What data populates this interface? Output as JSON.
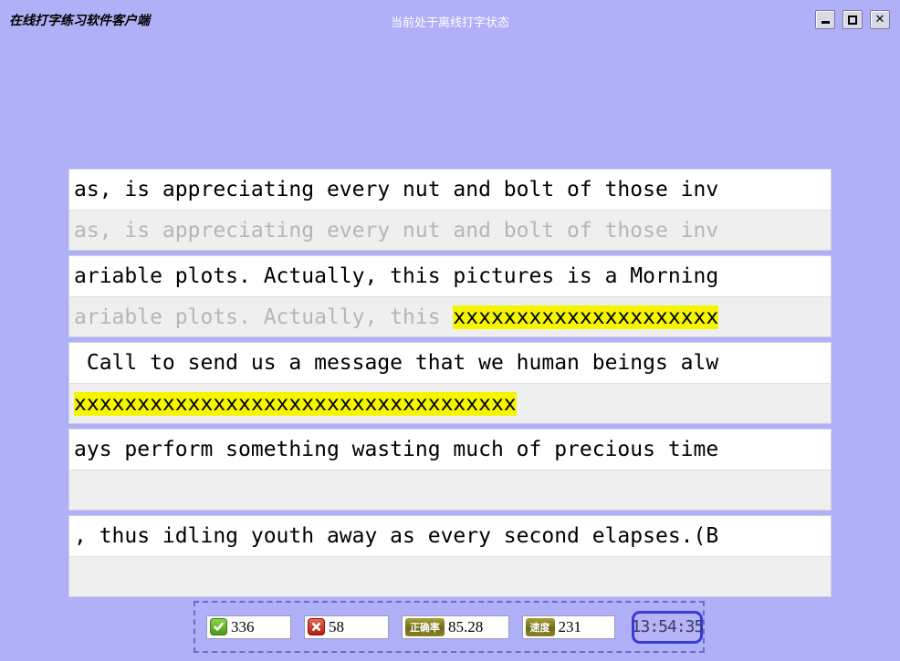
{
  "window": {
    "app_title": "在线打字练习软件客户端",
    "status_text": "当前处于离线打字状态",
    "minimize_label": "—",
    "maximize_label": "□",
    "close_label": "✕"
  },
  "typing": {
    "lines": [
      {
        "source": "as, is appreciating every nut and bolt of those inv",
        "typed_plain": "as, is appreciating every nut and bolt of those inv",
        "typed_error": ""
      },
      {
        "source": "ariable plots. Actually, this pictures is a Morning",
        "typed_plain": "ariable plots. Actually, this ",
        "typed_error": "xxxxxxxxxxxxxxxxxxxxx"
      },
      {
        "source": " Call to send us a message that we human beings alw",
        "typed_plain": "",
        "typed_error": "xxxxxxxxxxxxxxxxxxxxxxxxxxxxxxxxxxx"
      },
      {
        "source": "ays perform something wasting much of precious time",
        "typed_plain": "",
        "typed_error": ""
      },
      {
        "source": ", thus idling youth away as every second elapses.(B",
        "typed_plain": "",
        "typed_error": ""
      }
    ]
  },
  "stats": {
    "correct_count": "336",
    "wrong_count": "58",
    "accuracy_label": "正确率",
    "accuracy_value": "85.28",
    "speed_label": "速度",
    "speed_value": "231",
    "timer": "13:54:35"
  },
  "colors": {
    "background": "#b0b0f8",
    "highlight": "#f5f500",
    "timer_border": "#3a3ad8",
    "dashed_border": "#6a6ac8"
  }
}
